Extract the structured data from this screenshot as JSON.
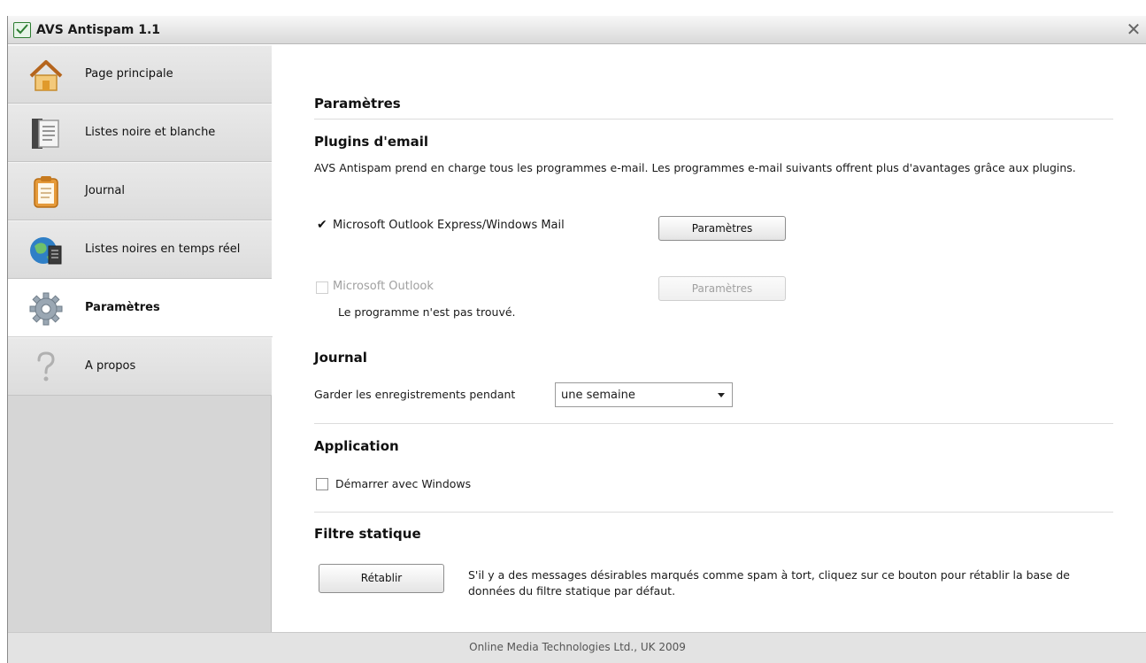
{
  "window": {
    "title": "AVS Antispam 1.1",
    "close_glyph": "✕"
  },
  "sidebar": {
    "items": [
      {
        "label": "Page principale",
        "icon": "home-icon"
      },
      {
        "label": "Listes noire et blanche",
        "icon": "list-document-icon"
      },
      {
        "label": "Journal",
        "icon": "clipboard-icon"
      },
      {
        "label": "Listes noires en temps réel",
        "icon": "globe-server-icon"
      },
      {
        "label": "Paramètres",
        "icon": "gear-icon",
        "active": true
      },
      {
        "label": "A propos",
        "icon": "question-icon"
      }
    ]
  },
  "main": {
    "title": "Paramètres",
    "plugins": {
      "title": "Plugins d'email",
      "description": "AVS Antispam prend en charge tous les programmes e-mail. Les programmes e-mail suivants offrent plus d'avantages grâce aux plugins.",
      "outlook_express": {
        "label": "Microsoft Outlook Express/Windows Mail",
        "checked": true,
        "button": "Paramètres"
      },
      "outlook": {
        "label": "Microsoft Outlook",
        "checked": false,
        "button": "Paramètres",
        "status": "Le programme n'est pas trouvé."
      }
    },
    "journal": {
      "title": "Journal",
      "keep_label": "Garder les enregistrements pendant",
      "keep_value": "une semaine"
    },
    "application": {
      "title": "Application",
      "startup_label": "Démarrer avec Windows",
      "startup_checked": false
    },
    "static_filter": {
      "title": "Filtre statique",
      "button": "Rétablir",
      "description": "S'il y a des messages désirables marqués comme spam à tort, cliquez sur ce bouton pour rétablir la base de données du filtre statique par défaut."
    }
  },
  "footer": {
    "text": "Online Media Technologies Ltd., UK 2009"
  },
  "colors": {
    "sidebar_bg": "#d6d6d6",
    "content_bg": "#ffffff",
    "app_icon_green": "#2e7d32"
  }
}
